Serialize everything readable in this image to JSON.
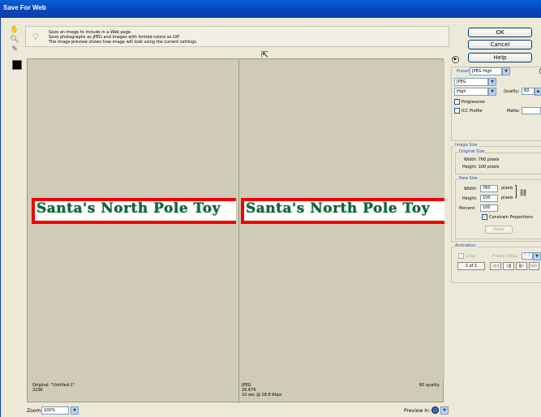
{
  "window": {
    "title": "Save For Web"
  },
  "info": {
    "lines": [
      "Save an image to include in a Web page.",
      "Save photographs as JPEG and images with limited colors as GIF.",
      "The Image preview shows how image will look using the current settings."
    ]
  },
  "buttons": {
    "ok": "OK",
    "cancel": "Cancel",
    "help": "Help"
  },
  "preview": {
    "banner_text": "Santa's North Pole Toy",
    "original": {
      "line1": "Original: \"Untitled-1\"",
      "line2": "223K"
    },
    "optimized": {
      "format": "JPEG",
      "size": "26.67K",
      "time": "10 sec @ 28.8 Kbps",
      "quality": "60 quality"
    }
  },
  "settings": {
    "preset_label": "Preset:",
    "preset_value": "JPEG High",
    "format_value": "JPEG",
    "compression_value": "High",
    "quality_label": "Quality:",
    "quality_value": "60",
    "progressive_label": "Progressive",
    "progressive_checked": false,
    "icc_label": "ICC Profile",
    "icc_checked": false,
    "matte_label": "Matte:"
  },
  "image_size": {
    "group_label": "Image Size",
    "original_label": "Original Size",
    "width_line": "Width: 760 pixels",
    "height_line": "Height: 100 pixels",
    "new_size_label": "New Size",
    "width_label": "Width:",
    "width_value": "760",
    "width_unit": "pixels",
    "height_label": "Height:",
    "height_value": "100",
    "height_unit": "pixels",
    "percent_label": "Percent:",
    "percent_value": "100",
    "constrain_label": "Constrain Proportions",
    "constrain_checked": true,
    "apply_label": "Apply"
  },
  "animation": {
    "group_label": "Animation",
    "loop_label": "Loop",
    "frame_delay_label": "Frame Delay:",
    "frame_delay_value": "0.2",
    "frame_counter": "1 of 1",
    "nav_glyphs": [
      "◁◁",
      "◁‖",
      "‖▷",
      "▷▷"
    ]
  },
  "statusbar": {
    "zoom_label": "Zoom:",
    "zoom_value": "100%",
    "preview_in_label": "Preview In:"
  },
  "colors": {
    "title_blue": "#0a5fd8",
    "text_green": "#0a6a35",
    "border_red": "#e00000",
    "group_blue": "#2050b0"
  }
}
